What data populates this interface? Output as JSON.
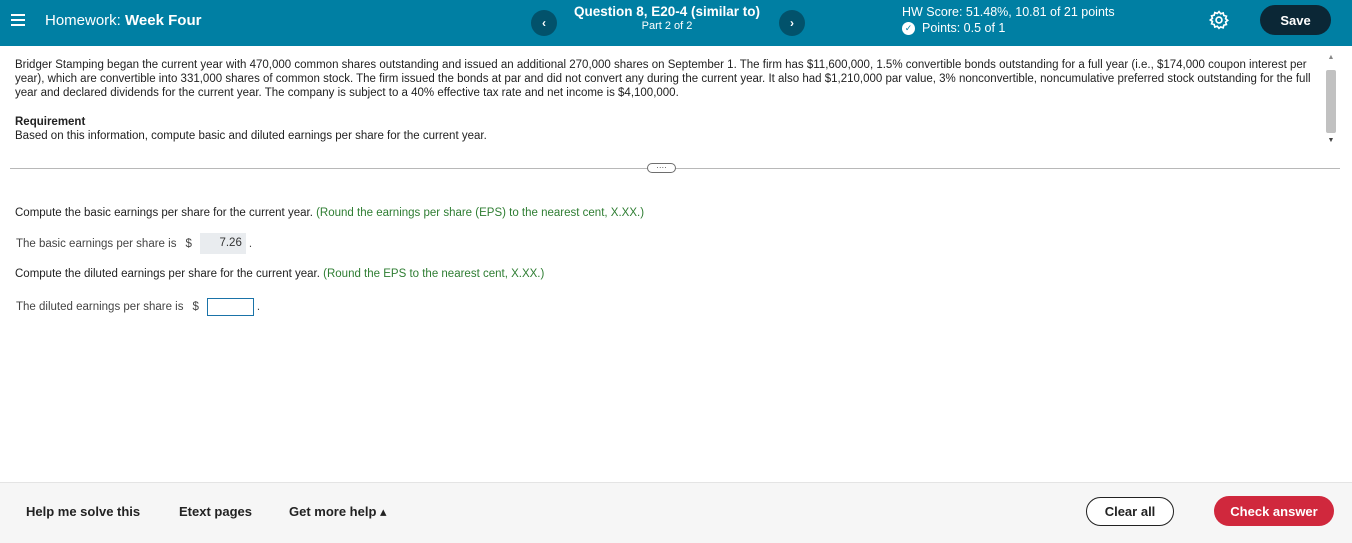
{
  "header": {
    "homework_prefix": "Homework:",
    "homework_name": "Week Four",
    "question_title": "Question 8, E20-4 (similar to)",
    "question_part": "Part 2 of 2",
    "prev_icon": "chevron-left",
    "next_icon": "chevron-right",
    "hw_score": "HW Score: 51.48%, 10.81 of 21 points",
    "points": "Points: 0.5 of 1",
    "save_label": "Save",
    "colors": {
      "bar": "#007fa3",
      "save": "#0b2736"
    }
  },
  "problem": {
    "text": "Bridger Stamping began the current year with 470,000 common shares outstanding and issued an additional 270,000 shares on September 1. The firm has $11,600,000, 1.5% convertible bonds outstanding for a full year (i.e., $174,000 coupon interest per year), which are convertible into 331,000 shares of common stock. The firm issued the bonds at par and did not convert any during the current year. It also had $1,210,000 par value, 3% nonconvertible, noncumulative preferred stock outstanding for the full year and declared dividends for the current year. The company is subject to a 40% effective tax rate and net income is $4,100,000.",
    "requirement_heading": "Requirement",
    "requirement_text": "Based on this information, compute basic and diluted earnings per share for the current year."
  },
  "questions": {
    "basic_prompt": "Compute the basic earnings per share for the current year.",
    "basic_hint": "(Round the earnings per share (EPS) to the nearest cent, X.XX.)",
    "basic_label": "The basic earnings per share is",
    "basic_currency": "$",
    "basic_value": "7.26",
    "diluted_prompt": "Compute the diluted earnings per share for the current year.",
    "diluted_hint": "(Round the EPS to the nearest cent, X.XX.)",
    "diluted_label": "The diluted earnings per share is",
    "diluted_currency": "$",
    "diluted_value": "",
    "period": "."
  },
  "footer": {
    "help_solve": "Help me solve this",
    "etext": "Etext pages",
    "more_help": "Get more help ▴",
    "clear_all": "Clear all",
    "check_answer": "Check answer",
    "colors": {
      "check": "#d0283d"
    }
  }
}
